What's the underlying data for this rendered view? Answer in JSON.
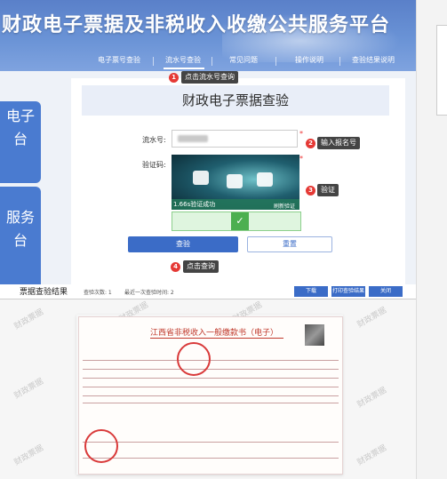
{
  "header": {
    "title": "财政电子票据及非税收入收缴公共服务平台",
    "nav": [
      "电子票号查验",
      "流水号查验",
      "常见问题",
      "操作说明",
      "查验结果说明"
    ],
    "active_index": 1
  },
  "sidebar": {
    "card1": "电子\n台",
    "card2": "服务\n台"
  },
  "form": {
    "heading": "财政电子票据查验",
    "serial_label": "流水号:",
    "captcha_label": "验证码:",
    "required_mark": "*",
    "captcha_status": "1.66s验证成功",
    "captcha_refresh": "刷新验证",
    "slider_check": "✓",
    "submit_label": "查验",
    "reset_label": "重置"
  },
  "annotations": [
    {
      "num": "1",
      "text": "点击流水号查询"
    },
    {
      "num": "2",
      "text": "输入报名号"
    },
    {
      "num": "3",
      "text": "验证"
    },
    {
      "num": "4",
      "text": "点击查询"
    }
  ],
  "results": {
    "title": "票据查验结果",
    "count_label": "查验次数: 1",
    "last_time_label": "最近一次查验时间: 2",
    "buttons": [
      "下载",
      "打印查验结果",
      "关闭"
    ]
  },
  "document": {
    "title": "江西省非税收入一般缴款书（电子）",
    "seal_text": "章",
    "watermark": "财政票据"
  },
  "colors": {
    "header_blue": "#5a80c9",
    "primary": "#3b6cc7",
    "annotation_red": "#e53935",
    "slider_green": "#4caf50"
  }
}
